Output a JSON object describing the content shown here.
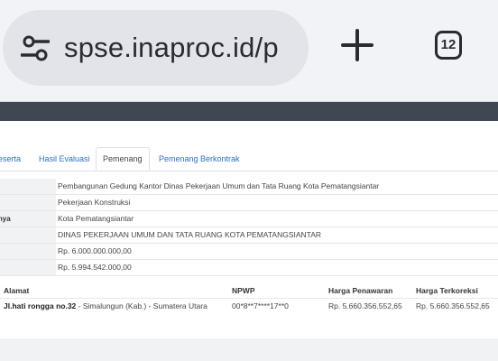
{
  "browser": {
    "url": "spse.inaproc.id/p",
    "tab_count": "12"
  },
  "tabs": [
    {
      "label": "eserta"
    },
    {
      "label": "Hasil Evaluasi"
    },
    {
      "label": "Pemenang"
    },
    {
      "label": "Pemenang Berkontrak"
    }
  ],
  "info": [
    {
      "label": "",
      "value": "Pembangunan Gedung Kantor Dinas Pekerjaan Umum dan Tata Ruang Kota Pematangsiantar"
    },
    {
      "label": "",
      "value": "Pekerjaan Konstruksi"
    },
    {
      "label": "nnya",
      "value": "Kota Pematangsiantar"
    },
    {
      "label": "",
      "value": "DINAS PEKERJAAN UMUM DAN TATA RUANG KOTA PEMATANGSIANTAR"
    },
    {
      "label": "",
      "value": "Rp. 6.000.000.000,00"
    },
    {
      "label": "",
      "value": "Rp. 5.994.542.000,00"
    }
  ],
  "table": {
    "headers": {
      "alamat": "Alamat",
      "npwp": "NPWP",
      "harga_penawaran": "Harga Penawaran",
      "harga_terkoreksi": "Harga Terkoreksi"
    },
    "rows": [
      {
        "alamat_bold": "Jl.hati rongga no.32",
        "alamat_rest": " - Simalungun (Kab.) - Sumatera Utara",
        "npwp": "00*8**7****17**0",
        "harga_penawaran": "Rp. 5.660.356.552,65",
        "harga_terkoreksi": "Rp. 5.660.356.552,65"
      }
    ]
  }
}
